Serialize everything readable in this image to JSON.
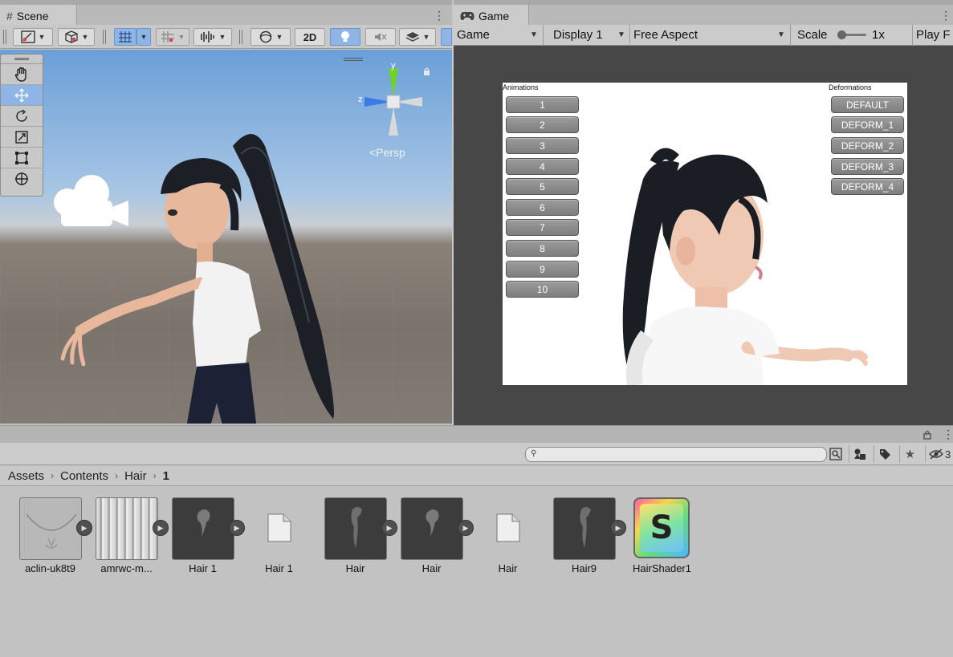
{
  "scene": {
    "tab_title": "Scene",
    "toolbar": {
      "mode_2d": "2D"
    },
    "persp_label": "<Persp",
    "gizmo": {
      "x": "x",
      "y": "y",
      "z": "z"
    }
  },
  "game": {
    "tab_title": "Game",
    "toolbar": {
      "view_dropdown": "Game",
      "display_dropdown": "Display 1",
      "aspect_dropdown": "Free Aspect",
      "scale_label": "Scale",
      "scale_value": "1x",
      "play_label": "Play F"
    },
    "view": {
      "animations_heading": "Animations",
      "deformations_heading": "Deformations",
      "animation_buttons": [
        "1",
        "2",
        "3",
        "4",
        "5",
        "6",
        "7",
        "8",
        "9",
        "10"
      ],
      "deformation_buttons": [
        "DEFAULT",
        "DEFORM_1",
        "DEFORM_2",
        "DEFORM_3",
        "DEFORM_4"
      ]
    }
  },
  "project": {
    "search": {
      "placeholder": ""
    },
    "visibility_count": "3",
    "breadcrumb": [
      "Assets",
      "Contents",
      "Hair",
      "1"
    ],
    "assets": [
      {
        "label": "aclin-uk8t9",
        "icon": "texture-icon"
      },
      {
        "label": "amrwc-m...",
        "icon": "texture-icon"
      },
      {
        "label": "Hair 1",
        "icon": "model-icon"
      },
      {
        "label": "Hair 1",
        "icon": "file-icon"
      },
      {
        "label": "Hair",
        "icon": "model-icon"
      },
      {
        "label": "Hair",
        "icon": "model-icon"
      },
      {
        "label": "Hair",
        "icon": "file-icon"
      },
      {
        "label": "Hair9",
        "icon": "model-icon"
      },
      {
        "label": "HairShader1",
        "icon": "shader-icon",
        "glyph": "S"
      }
    ]
  },
  "colors": {
    "accent_selected": "#8fb5e6",
    "gizmo_y": "#6fd22e",
    "gizmo_z": "#3b7be8",
    "game_button": "#8a8a8a"
  }
}
